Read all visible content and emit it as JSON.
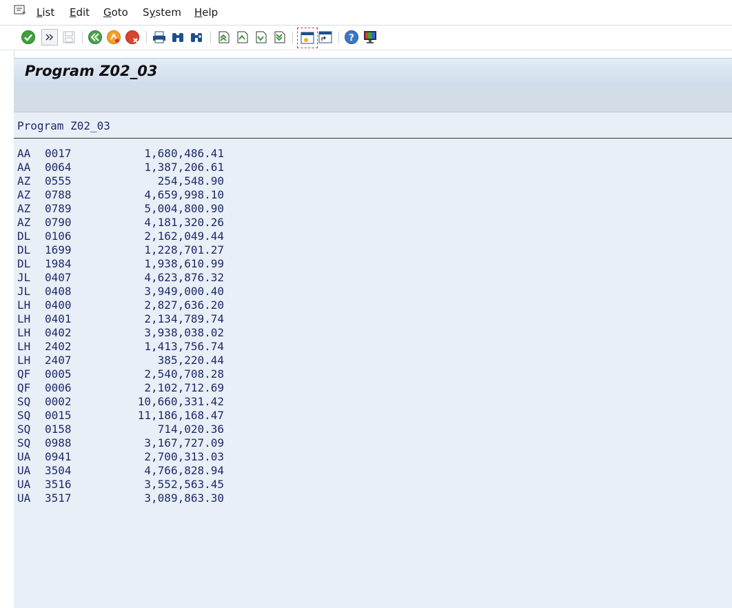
{
  "menu": {
    "items": [
      "List",
      "Edit",
      "Goto",
      "System",
      "Help"
    ]
  },
  "toolbar": {
    "buttons": [
      {
        "name": "enter",
        "icon": "check-icon"
      },
      {
        "name": "command-field-toggle",
        "icon": "double-chevron-icon"
      },
      {
        "name": "save",
        "icon": "save-icon"
      },
      {
        "name": "back",
        "icon": "back-icon"
      },
      {
        "name": "exit",
        "icon": "exit-icon"
      },
      {
        "name": "cancel",
        "icon": "cancel-icon"
      },
      {
        "name": "print",
        "icon": "print-icon"
      },
      {
        "name": "find",
        "icon": "find-icon"
      },
      {
        "name": "find-next",
        "icon": "find-next-icon"
      },
      {
        "name": "first-page",
        "icon": "first-page-icon"
      },
      {
        "name": "previous-page",
        "icon": "previous-page-icon"
      },
      {
        "name": "next-page",
        "icon": "next-page-icon"
      },
      {
        "name": "last-page",
        "icon": "last-page-icon"
      },
      {
        "name": "create-session",
        "icon": "new-window-icon"
      },
      {
        "name": "generate-shortcut",
        "icon": "shortcut-icon"
      },
      {
        "name": "help",
        "icon": "help-icon"
      },
      {
        "name": "layout-menu",
        "icon": "monitor-icon"
      }
    ]
  },
  "title": "Program Z02_03",
  "list": {
    "header": "Program Z02_03",
    "rows": [
      {
        "carrier": "AA",
        "conn": "0017",
        "amount": "1,680,486.41"
      },
      {
        "carrier": "AA",
        "conn": "0064",
        "amount": "1,387,206.61"
      },
      {
        "carrier": "AZ",
        "conn": "0555",
        "amount": "254,548.90"
      },
      {
        "carrier": "AZ",
        "conn": "0788",
        "amount": "4,659,998.10"
      },
      {
        "carrier": "AZ",
        "conn": "0789",
        "amount": "5,004,800.90"
      },
      {
        "carrier": "AZ",
        "conn": "0790",
        "amount": "4,181,320.26"
      },
      {
        "carrier": "DL",
        "conn": "0106",
        "amount": "2,162,049.44"
      },
      {
        "carrier": "DL",
        "conn": "1699",
        "amount": "1,228,701.27"
      },
      {
        "carrier": "DL",
        "conn": "1984",
        "amount": "1,938,610.99"
      },
      {
        "carrier": "JL",
        "conn": "0407",
        "amount": "4,623,876.32"
      },
      {
        "carrier": "JL",
        "conn": "0408",
        "amount": "3,949,000.40"
      },
      {
        "carrier": "LH",
        "conn": "0400",
        "amount": "2,827,636.20"
      },
      {
        "carrier": "LH",
        "conn": "0401",
        "amount": "2,134,789.74"
      },
      {
        "carrier": "LH",
        "conn": "0402",
        "amount": "3,938,038.02"
      },
      {
        "carrier": "LH",
        "conn": "2402",
        "amount": "1,413,756.74"
      },
      {
        "carrier": "LH",
        "conn": "2407",
        "amount": "385,220.44"
      },
      {
        "carrier": "QF",
        "conn": "0005",
        "amount": "2,540,708.28"
      },
      {
        "carrier": "QF",
        "conn": "0006",
        "amount": "2,102,712.69"
      },
      {
        "carrier": "SQ",
        "conn": "0002",
        "amount": "10,660,331.42"
      },
      {
        "carrier": "SQ",
        "conn": "0015",
        "amount": "11,186,168.47"
      },
      {
        "carrier": "SQ",
        "conn": "0158",
        "amount": "714,020.36"
      },
      {
        "carrier": "SQ",
        "conn": "0988",
        "amount": "3,167,727.09"
      },
      {
        "carrier": "UA",
        "conn": "0941",
        "amount": "2,700,313.03"
      },
      {
        "carrier": "UA",
        "conn": "3504",
        "amount": "4,766,828.94"
      },
      {
        "carrier": "UA",
        "conn": "3516",
        "amount": "3,552,563.45"
      },
      {
        "carrier": "UA",
        "conn": "3517",
        "amount": "3,089,863.30"
      }
    ]
  },
  "colors": {
    "list_text": "#1d2a6b",
    "list_bg": "#e9eff6",
    "title_bg": "#cfdceb"
  }
}
